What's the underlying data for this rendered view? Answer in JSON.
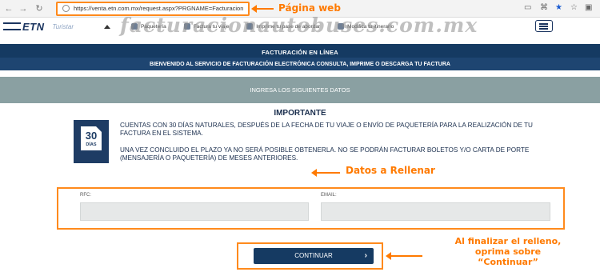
{
  "browser": {
    "url": "https://venta.etn.com.mx/request.aspx?PRGNAME=Facturacion",
    "back_icon": "back-arrow-icon",
    "forward_icon": "forward-arrow-icon",
    "reload_icon": "reload-icon"
  },
  "annotations": {
    "url_label": "Página web",
    "fields_label": "Datos a Rellenar",
    "button_note_line1": "Al finalizar el relleno,",
    "button_note_line2": "oprima sobre",
    "button_note_line3": "“Continuar”",
    "accent_color": "#ff7a00"
  },
  "site": {
    "logo_text": "ETN",
    "logo_tagline": "Turistar",
    "watermark": "facturacionautobuses.com.mx",
    "nav": [
      {
        "label": "Paquetería",
        "icon": "package-icon"
      },
      {
        "label": "Factura tu viaje",
        "icon": "invoice-icon"
      },
      {
        "label": "Imprime tu pase de abordar",
        "icon": "print-icon"
      },
      {
        "label": "Modifica tu itinerario",
        "icon": "edit-icon"
      }
    ]
  },
  "banner": {
    "title": "FACTURACIÓN EN LÍNEA",
    "subtitle": "BIENVENIDO AL SERVICIO DE FACTURACIÓN ELECTRÓNICA CONSULTA, IMPRIME O DESCARGA TU FACTURA",
    "data_prompt": "INGRESA LOS SIGUIENTES DATOS",
    "primary_color": "#153a62",
    "secondary_color": "#8aa0a2"
  },
  "important": {
    "title": "IMPORTANTE",
    "icon_number": "30",
    "icon_label": "DÍAS",
    "paragraph1": "CUENTAS CON 30 DÍAS NATURALES, DESPUÉS DE LA FECHA DE TU VIAJE O ENVÍO DE PAQUETERÍA PARA LA REALIZACIÓN DE TU FACTURA EN EL SISTEMA.",
    "paragraph2": "UNA VEZ CONCLUIDO EL PLAZO YA NO SERÁ POSIBLE OBTENERLA. NO SE PODRÁN FACTURAR BOLETOS Y/O CARTA DE PORTE (MENSAJERÍA O PAQUETERÍA) DE MESES ANTERIORES."
  },
  "form": {
    "rfc_label": "RFC:",
    "rfc_value": "",
    "email_label": "EMAIL:",
    "email_value": "",
    "continue_label": "CONTINUAR",
    "continue_chevron": "›"
  }
}
